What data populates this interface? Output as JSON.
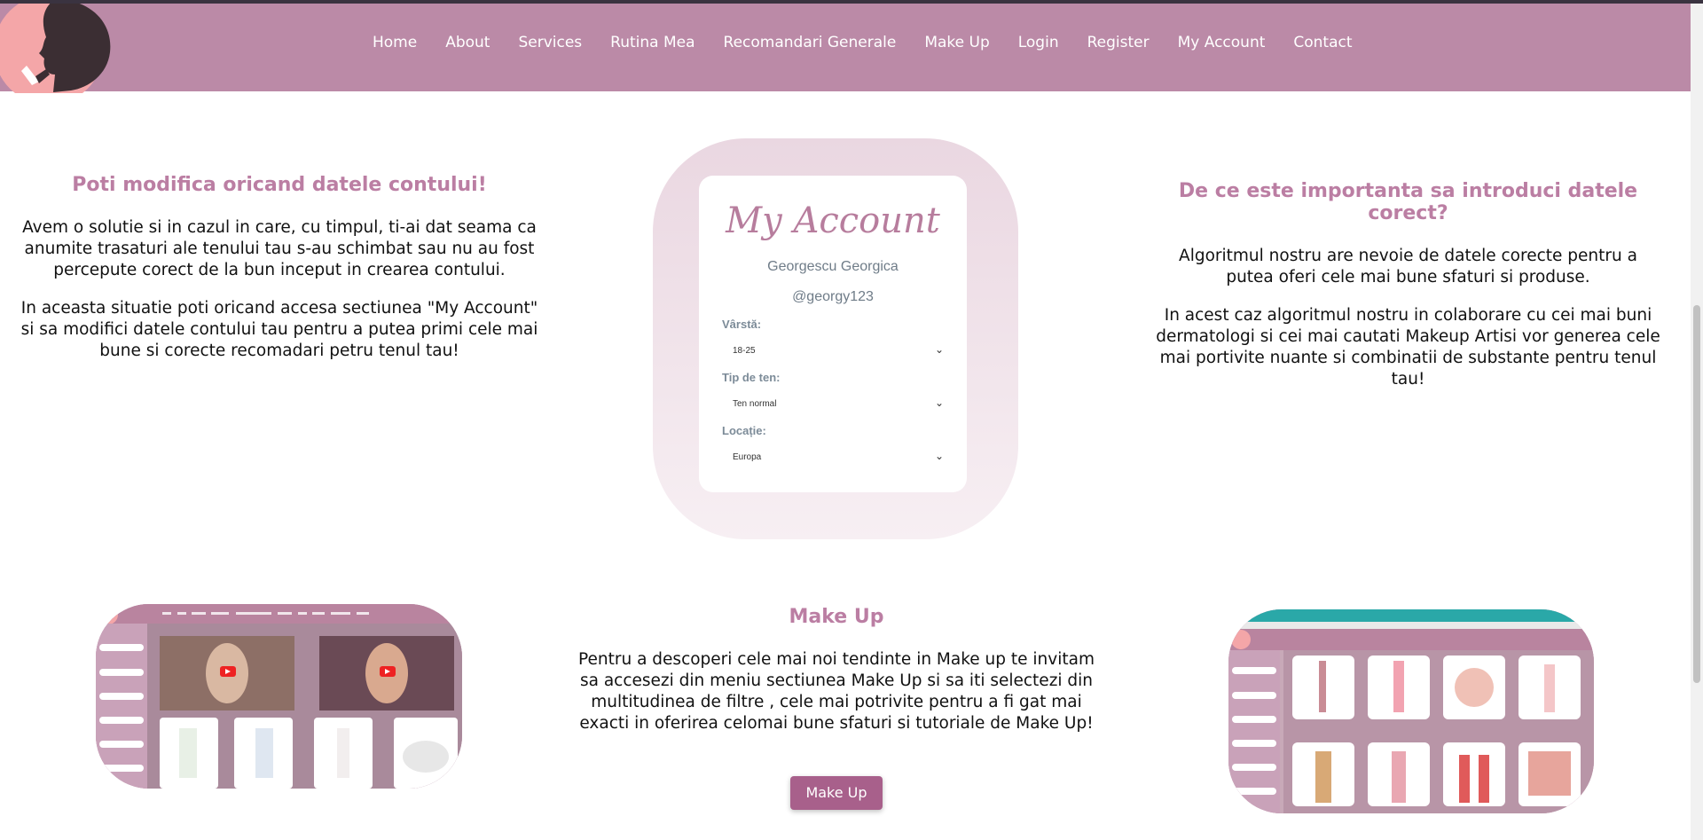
{
  "nav": {
    "items": [
      "Home",
      "About",
      "Services",
      "Rutina Mea",
      "Recomandari Generale",
      "Make Up",
      "Login",
      "Register",
      "My Account",
      "Contact"
    ]
  },
  "left": {
    "title": "Poti modifica oricand datele contului!",
    "p1": "Avem o solutie si in cazul in care, cu timpul, ti-ai dat seama ca anumite trasaturi ale tenului tau s-au schimbat sau nu au fost percepute corect de la bun inceput in crearea contului.",
    "p2": "In aceasta situatie poti oricand accesa sectiunea \"My Account\" si sa modifici datele contului tau pentru a putea primi cele mai bune si corecte recomadari petru tenul tau!"
  },
  "account": {
    "title": "My Account",
    "name": "Georgescu Georgica",
    "username": "@georgy123",
    "age_label": "Vârstă:",
    "age_value": "18-25",
    "skin_label": "Tip de ten:",
    "skin_value": "Ten normal",
    "location_label": "Locație:",
    "location_value": "Europa"
  },
  "right": {
    "title": "De ce este importanta sa introduci datele corect?",
    "p1": "Algoritmul nostru are nevoie de datele corecte pentru a putea oferi cele mai bune sfaturi si produse.",
    "p2": "In acest caz algoritmul nostru in colaborare cu cei mai buni dermatologi si cei mai cautati Makeup Artisi vor generea cele mai portivite nuante si combinatii de substante pentru tenul tau!"
  },
  "makeup": {
    "title": "Make Up",
    "p1": "Pentru a descoperi cele mai noi tendinte in Make up te invitam sa accesezi din meniu sectiunea Make Up si sa iti selectezi din multitudinea de filtre , cele mai potrivite pentru a fi gat mai exacti in oferirea celomai bune sfaturi si tutoriale de Make Up!",
    "button": "Make Up"
  },
  "colors": {
    "header": "#bb8aa7",
    "accent_title": "#bb7ea3",
    "button": "#a8608b"
  }
}
